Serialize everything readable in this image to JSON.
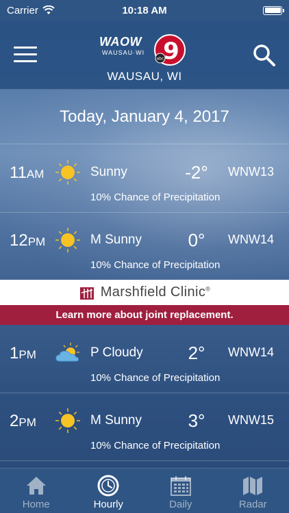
{
  "status_bar": {
    "carrier": "Carrier",
    "time": "10:18 AM"
  },
  "header": {
    "logo_text": "WAOW",
    "logo_sub": "WAUSAU·WI",
    "logo_number": "9",
    "logo_abc": "abc",
    "location": "WAUSAU, WI"
  },
  "date": "Today, January 4, 2017",
  "hours": [
    {
      "hour": "11",
      "ampm": "AM",
      "icon": "sun-icon",
      "condition": "Sunny",
      "temp": "-2°",
      "wind": "WNW13",
      "precip": "10% Chance of Precipitation"
    },
    {
      "hour": "12",
      "ampm": "PM",
      "icon": "sun-icon",
      "condition": "M Sunny",
      "temp": "0°",
      "wind": "WNW14",
      "precip": "10% Chance of Precipitation"
    },
    {
      "hour": "1",
      "ampm": "PM",
      "icon": "partly-cloudy-icon",
      "condition": "P Cloudy",
      "temp": "2°",
      "wind": "WNW14",
      "precip": "10% Chance of Precipitation"
    },
    {
      "hour": "2",
      "ampm": "PM",
      "icon": "sun-icon",
      "condition": "M Sunny",
      "temp": "3°",
      "wind": "WNW15",
      "precip": "10% Chance of Precipitation"
    }
  ],
  "ad": {
    "brand": "Marshfield Clinic",
    "mark": "®",
    "tagline": "Learn more about joint replacement."
  },
  "tabs": [
    {
      "label": "Home",
      "icon": "home-icon"
    },
    {
      "label": "Hourly",
      "icon": "clock-icon"
    },
    {
      "label": "Daily",
      "icon": "calendar-icon"
    },
    {
      "label": "Radar",
      "icon": "map-icon"
    }
  ],
  "colors": {
    "header": "#2f5584",
    "ad_banner": "#a01f3f",
    "sun": "#f7c325",
    "tab_inactive": "rgba(255,255,255,0.55)"
  }
}
